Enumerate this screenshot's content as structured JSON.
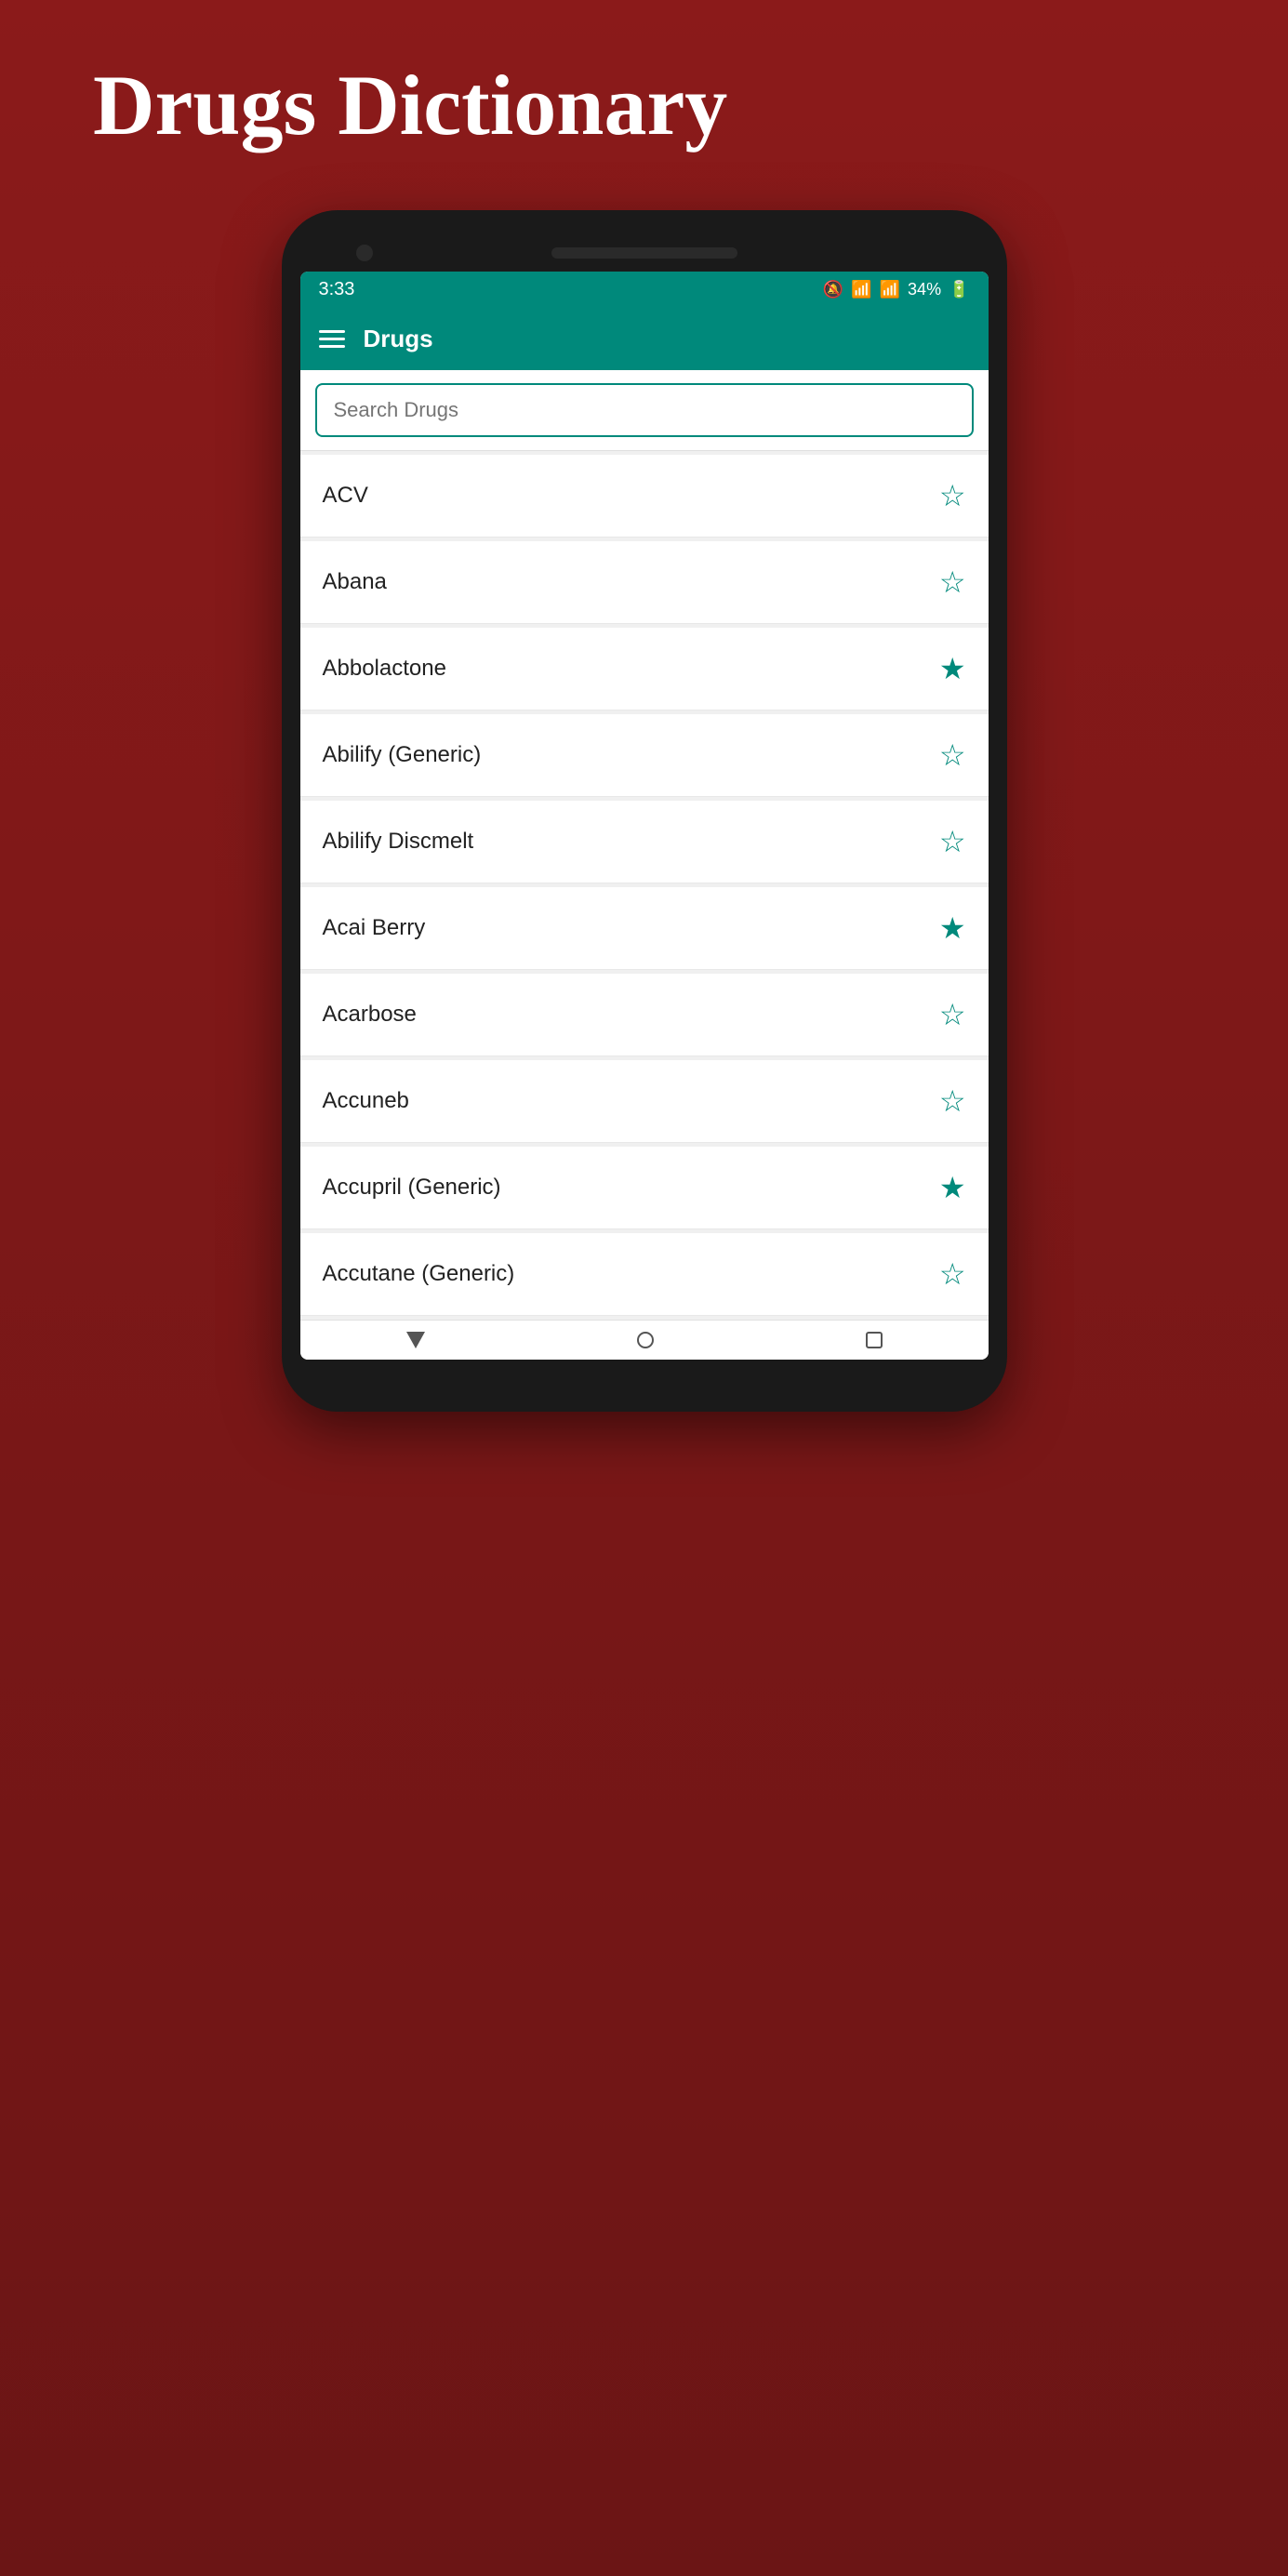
{
  "page": {
    "title": "Drugs Dictionary",
    "background_color": "#7B1818"
  },
  "status_bar": {
    "time": "3:33",
    "battery": "34%",
    "icons": [
      "🔕",
      "📶",
      "📶"
    ]
  },
  "app_bar": {
    "title": "Drugs"
  },
  "search": {
    "placeholder": "Search Drugs",
    "value": ""
  },
  "drug_list": [
    {
      "name": "ACV",
      "favorited": false
    },
    {
      "name": "Abana",
      "favorited": false
    },
    {
      "name": "Abbolactone",
      "favorited": true
    },
    {
      "name": "Abilify (Generic)",
      "favorited": false
    },
    {
      "name": "Abilify Discmelt",
      "favorited": false
    },
    {
      "name": "Acai Berry",
      "favorited": true
    },
    {
      "name": "Acarbose",
      "favorited": false
    },
    {
      "name": "Accuneb",
      "favorited": false
    },
    {
      "name": "Accupril (Generic)",
      "favorited": true
    },
    {
      "name": "Accutane (Generic)",
      "favorited": false
    }
  ],
  "labels": {
    "hamburger": "Menu",
    "search_icon": "search"
  }
}
